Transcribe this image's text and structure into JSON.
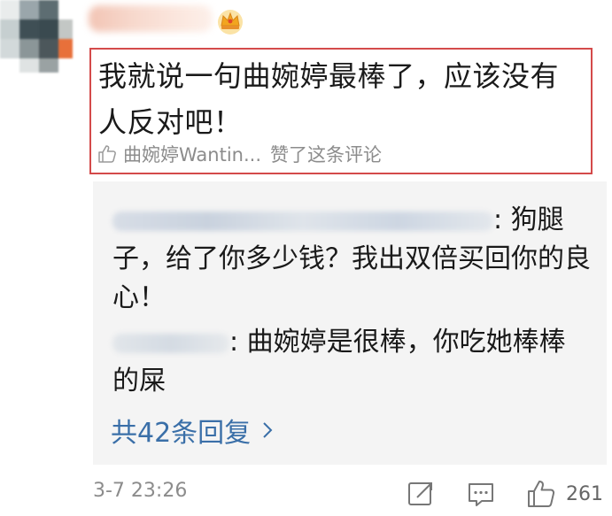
{
  "comment": {
    "text": "我就说一句曲婉婷最棒了，应该没有人反对吧！",
    "liked_by_name": "曲婉婷Wantin...",
    "liked_by_suffix": "赞了这条评论"
  },
  "replies": [
    {
      "text": ": 狗腿子，给了你多少钱？我出双倍买回你的良心！"
    },
    {
      "text": ": 曲婉婷是很棒，你吃她棒棒的屎"
    }
  ],
  "more_replies_label": "共42条回复",
  "footer": {
    "timestamp": "3-7 23:26",
    "like_count": "261"
  },
  "colors": {
    "highlight_border": "#d44a4a",
    "link": "#3a6fa8",
    "reply_bg": "#f4f4f4",
    "muted_text": "#8c8c8c"
  }
}
